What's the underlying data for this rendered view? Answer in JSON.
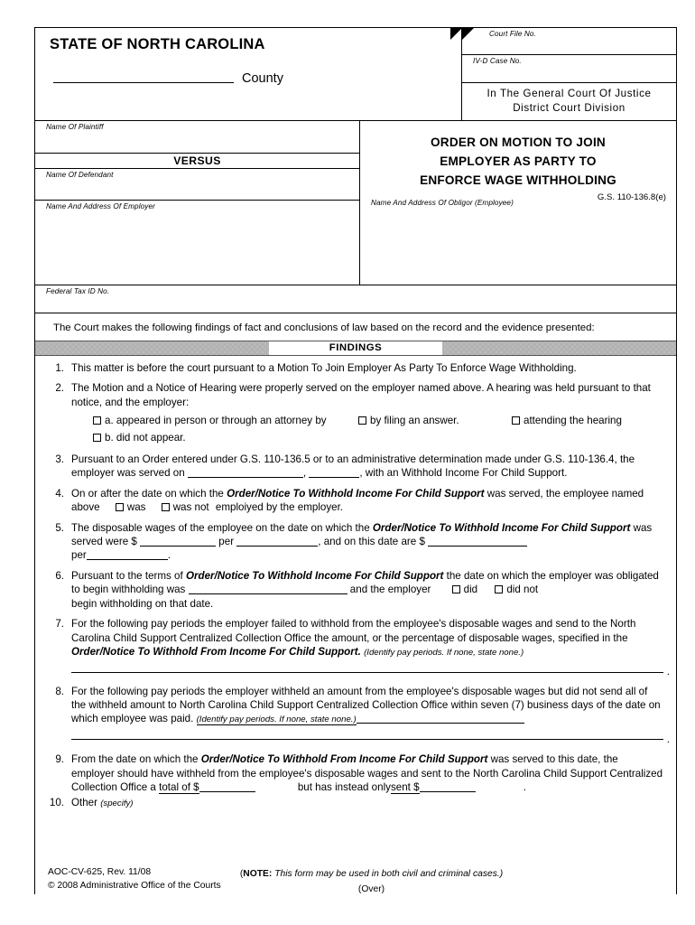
{
  "header": {
    "state_title": "STATE OF NORTH CAROLINA",
    "county_label": "County",
    "court_file_label": "Court File No.",
    "ivd_case_label": "IV-D Case No.",
    "court_line_1": "In The General Court Of Justice",
    "court_line_2": "District Court Division"
  },
  "parties": {
    "plaintiff_label": "Name Of Plaintiff",
    "versus_label": "VERSUS",
    "defendant_label": "Name Of Defendant",
    "employer_label": "Name And Address Of Employer",
    "obligor_label": "Name And Address Of Obligor (Employee)",
    "federal_tax_id_label": "Federal Tax ID No."
  },
  "form": {
    "title_line_1": "ORDER ON MOTION TO JOIN",
    "title_line_2": "EMPLOYER AS PARTY TO",
    "title_line_3": "ENFORCE WAGE WITHHOLDING",
    "statute": "G.S. 110-136.8(e)"
  },
  "intro": {
    "text": "The Court makes the following findings of fact and conclusions of law based on the record and the evidence presented:"
  },
  "findings": {
    "bar_label": "FINDINGS",
    "items": [
      {
        "num": "1.",
        "text": "This matter is before the court pursuant to a Motion To Join Employer As Party To Enforce Wage Withholding."
      },
      {
        "num": "2.",
        "text": "The Motion and a Notice of Hearing were properly served on the employer named above. A hearing was held pursuant to that notice, and the employer:",
        "option_a": "a.   appeared in person or through an attorney by",
        "option_a2": "by filing an answer.",
        "option_a3": "attending the hearing",
        "option_b": "b.  did not appear."
      },
      {
        "num": "3.",
        "text_1": "Pursuant to an Order entered under G.S. 110-136.5 or to an administrative determination made under G.S. 110-136.4, the employer was served on",
        "text_2": ",",
        "text_3": ", with an Withhold Income For Child Support."
      },
      {
        "num": "4.",
        "text_1": "On or after the date on which the",
        "emph": "Order/Notice To Withhold Income For Child Support",
        "text_2": "was served, the employee named above",
        "opt_was": "was",
        "opt_was_not": "was not",
        "text_3": "emploiyed by the employer."
      },
      {
        "num": "5.",
        "text_1": "The disposable wages of the employee on the date on which the",
        "emph": "Order/Notice To Withhold Income For Child",
        "emph2": "Support",
        "text_2": "was served were $",
        "text_3": "per",
        "text_4": ", and on this date are $",
        "text_5": "per",
        "text_6": "."
      },
      {
        "num": "6.",
        "text_1": "Pursuant to the terms of",
        "emph": "Order/Notice To Withhold Income For Child Support",
        "text_2": "the date on which the employer was obligated to begin withholding was",
        "text_3": "and the employer",
        "opt_did": "did",
        "opt_did_not": "did not",
        "text_4": "begin withholding on that date."
      },
      {
        "num": "7.",
        "text_1": "For the following pay periods the employer failed to withhold from the employee's disposable wages and send to the North Carolina Child Support Centralized Collection Office the amount, or the percentage of disposable wages, specified in the",
        "emph": "Order/Notice To Withhold From Income For Child Support.",
        "paren": "(Identify pay periods. If none, state none.)"
      },
      {
        "num": "8.",
        "text_1": "For the following pay periods the employer withheld an amount from the employee's disposable wages but did not send all of the withheld amount to North Carolina Child Support Centralized Collection Office within seven (7) business days of the date on which employee was paid.",
        "paren": "(Identify pay periods. If none, state none.)"
      },
      {
        "num": "9.",
        "text_1": "From the date on which the",
        "emph": "Order/Notice To Withhold From Income For Child Support",
        "text_2": "was served to this date, the employer should have withheld from the employee's disposable wages and sent to the North Carolina Child Support Centralized Collection Office a",
        "text_3": "total of $",
        "text_4": "but has instead only",
        "text_5": "sent $",
        "text_6": "."
      },
      {
        "num": "10.",
        "text_1": "Other",
        "paren": "(specify)"
      }
    ]
  },
  "footer": {
    "note_bold": "NOTE:",
    "note_text": "This form may be used in both civil and criminal cases.)",
    "note_open": "(",
    "over": "(Over)",
    "form_id": "AOC-CV-625, Rev. 11/08",
    "copyright": "© 2008 Administrative Office of the Courts"
  }
}
